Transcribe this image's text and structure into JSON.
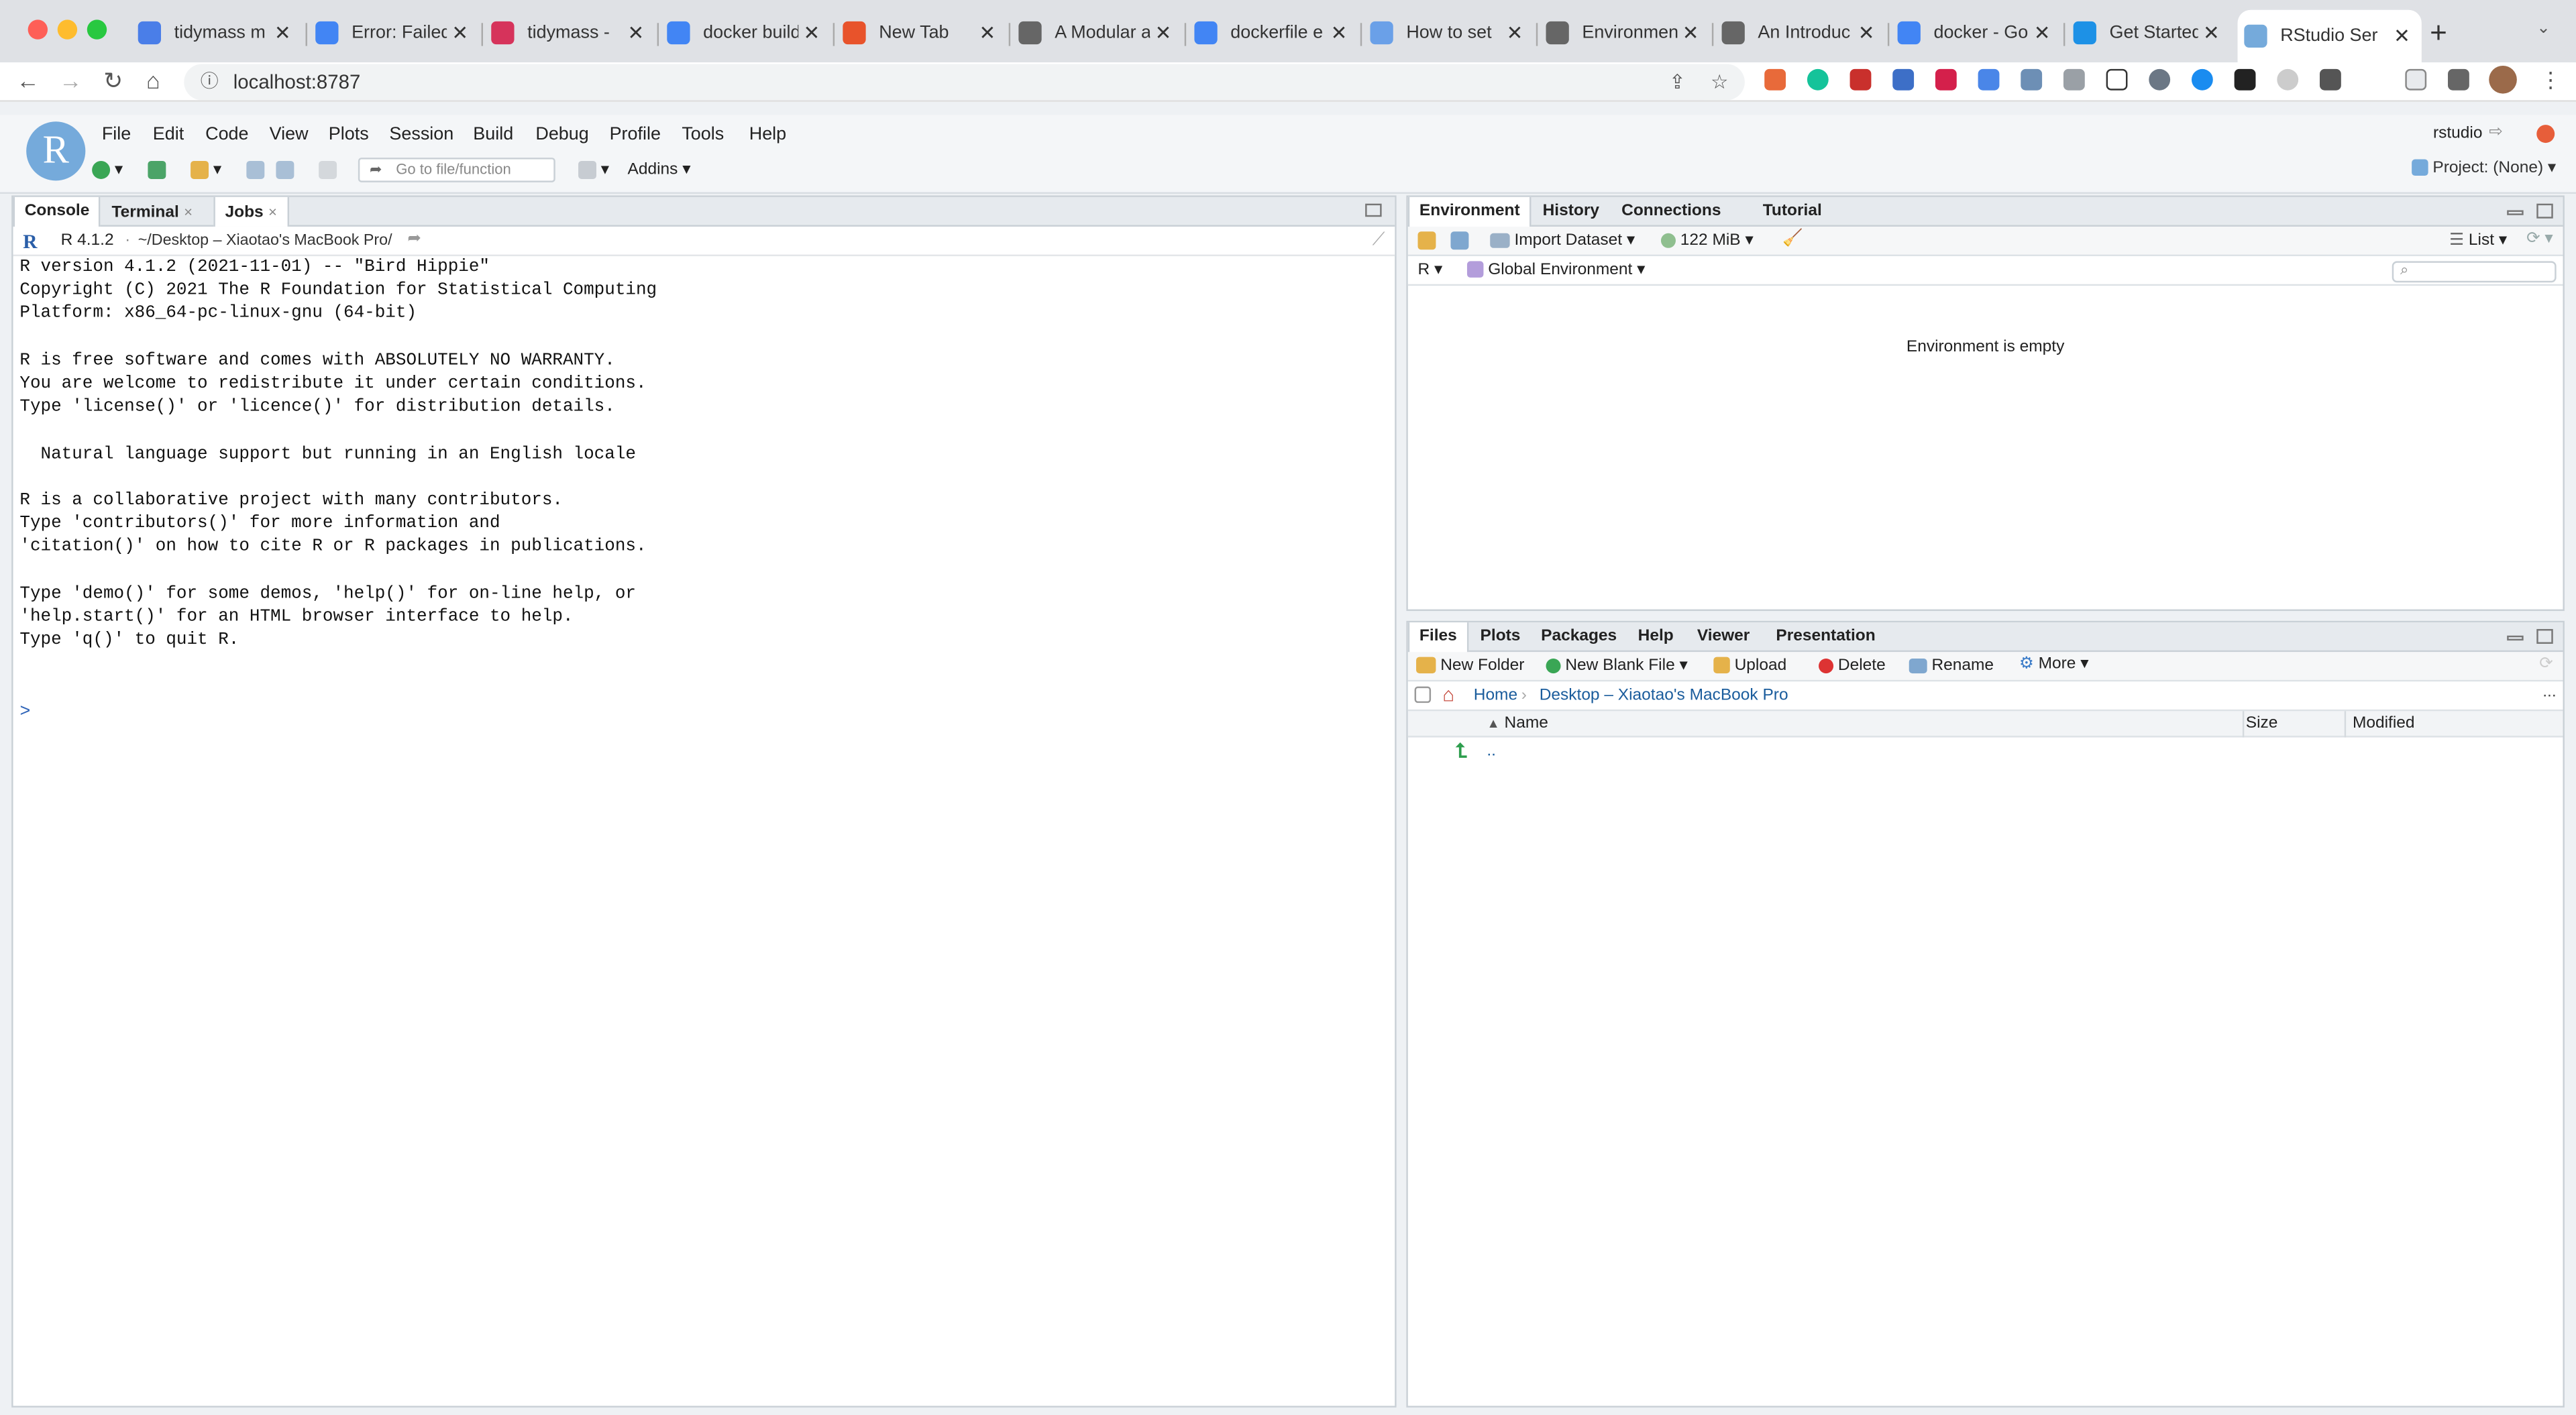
{
  "browser": {
    "tabs": [
      {
        "title": "tidymass m",
        "icon": "docs-icon",
        "color": "#4a7ee8"
      },
      {
        "title": "Error: Failed",
        "icon": "google-icon",
        "color": "#4285f4"
      },
      {
        "title": "tidymass -",
        "icon": "github-icon",
        "color": "#d6335b"
      },
      {
        "title": "docker build",
        "icon": "google-icon",
        "color": "#4285f4"
      },
      {
        "title": "New Tab",
        "icon": "infinity-icon",
        "color": "#e8532b"
      },
      {
        "title": "A Modular a",
        "icon": "globe-icon",
        "color": "#666"
      },
      {
        "title": "dockerfile e",
        "icon": "google-icon",
        "color": "#4285f4"
      },
      {
        "title": "How to set",
        "icon": "blob-icon",
        "color": "#6aa0e8"
      },
      {
        "title": "Environmen",
        "icon": "globe-icon",
        "color": "#666"
      },
      {
        "title": "An Introduc",
        "icon": "globe-icon",
        "color": "#666"
      },
      {
        "title": "docker - Go",
        "icon": "google-icon",
        "color": "#4285f4"
      },
      {
        "title": "Get Started",
        "icon": "docker-icon",
        "color": "#1d91e6"
      },
      {
        "title": "RStudio Ser",
        "icon": "rstudio-icon",
        "color": "#75aadb"
      }
    ],
    "url": "localhost:8787"
  },
  "rstudio": {
    "menu": [
      "File",
      "Edit",
      "Code",
      "View",
      "Plots",
      "Session",
      "Build",
      "Debug",
      "Profile",
      "Tools",
      "Help"
    ],
    "user": "rstudio",
    "goto_placeholder": "Go to file/function",
    "addins": "Addins",
    "project": "Project: (None)"
  },
  "console_pane": {
    "tabs": [
      "Console",
      "Terminal",
      "Jobs"
    ],
    "r_version": "R 4.1.2",
    "path": "~/Desktop – Xiaotao's MacBook Pro/",
    "lines": [
      "R version 4.1.2 (2021-11-01) -- \"Bird Hippie\"",
      "Copyright (C) 2021 The R Foundation for Statistical Computing",
      "Platform: x86_64-pc-linux-gnu (64-bit)",
      "",
      "R is free software and comes with ABSOLUTELY NO WARRANTY.",
      "You are welcome to redistribute it under certain conditions.",
      "Type 'license()' or 'licence()' for distribution details.",
      "",
      "  Natural language support but running in an English locale",
      "",
      "R is a collaborative project with many contributors.",
      "Type 'contributors()' for more information and",
      "'citation()' on how to cite R or R packages in publications.",
      "",
      "Type 'demo()' for some demos, 'help()' for on-line help, or",
      "'help.start()' for an HTML browser interface to help.",
      "Type 'q()' to quit R.",
      ""
    ],
    "prompt": ">"
  },
  "env_pane": {
    "tabs": [
      "Environment",
      "History",
      "Connections",
      "Tutorial"
    ],
    "import_dataset": "Import Dataset",
    "memory": "122 MiB",
    "view_mode": "List",
    "language": "R",
    "scope": "Global Environment",
    "empty_message": "Environment is empty"
  },
  "files_pane": {
    "tabs": [
      "Files",
      "Plots",
      "Packages",
      "Help",
      "Viewer",
      "Presentation"
    ],
    "actions": {
      "new_folder": "New Folder",
      "new_blank_file": "New Blank File",
      "upload": "Upload",
      "delete": "Delete",
      "rename": "Rename",
      "more": "More"
    },
    "breadcrumb": [
      "Home",
      "Desktop – Xiaotao's MacBook Pro"
    ],
    "columns": [
      "Name",
      "Size",
      "Modified"
    ],
    "rows": [
      ".."
    ],
    "more_dots": "..."
  },
  "colors": {
    "rstudio_blue": "#75aadb",
    "link": "#1a5c9c",
    "prompt": "#2f64b8"
  }
}
